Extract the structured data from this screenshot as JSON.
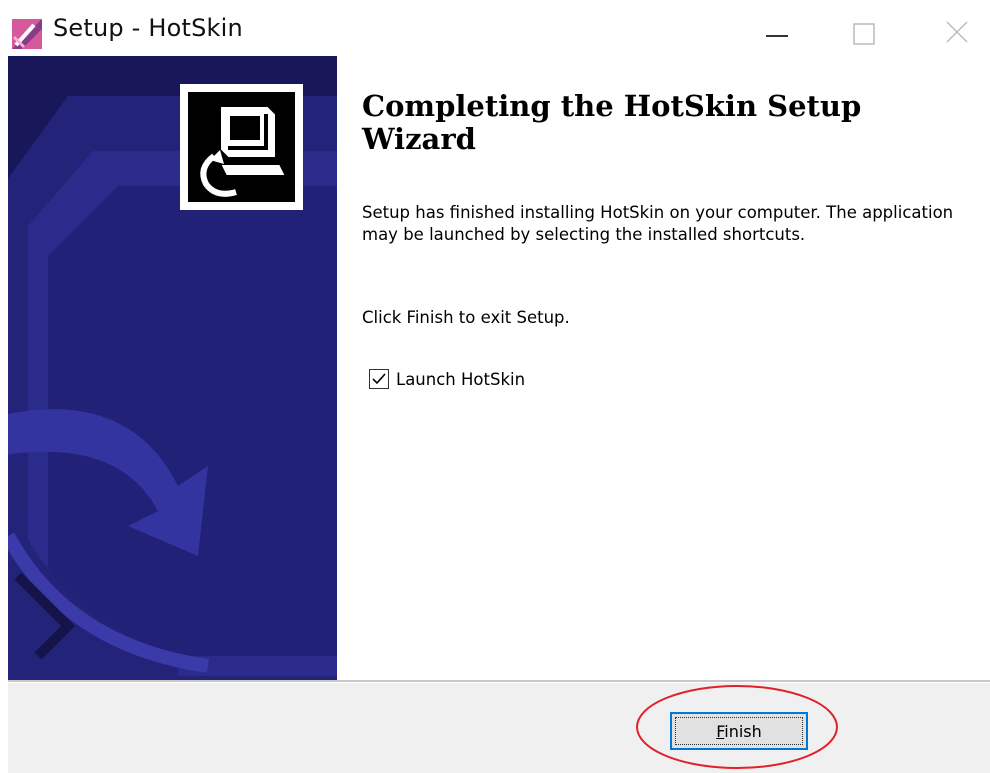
{
  "window": {
    "title": "Setup - HotSkin",
    "icon": "hotskin-app-icon"
  },
  "title_controls": {
    "minimize_icon": "minimize-icon",
    "maximize_icon": "maximize-icon",
    "close_icon": "close-icon"
  },
  "banner": {
    "logo_icon": "computer-install-icon",
    "background_color": "#1a1a5a"
  },
  "content": {
    "heading": "Completing the HotSkin Setup Wizard",
    "body": "Setup has finished installing HotSkin on your computer. The application may be launched by selecting the installed shortcuts.",
    "finish_instruction": "Click Finish to exit Setup.",
    "launch_checkbox": {
      "label": "Launch HotSkin",
      "checked": true
    }
  },
  "footer": {
    "finish_button": "Finish",
    "accelerator_key": "F",
    "highlight_color": "#e0202a"
  }
}
